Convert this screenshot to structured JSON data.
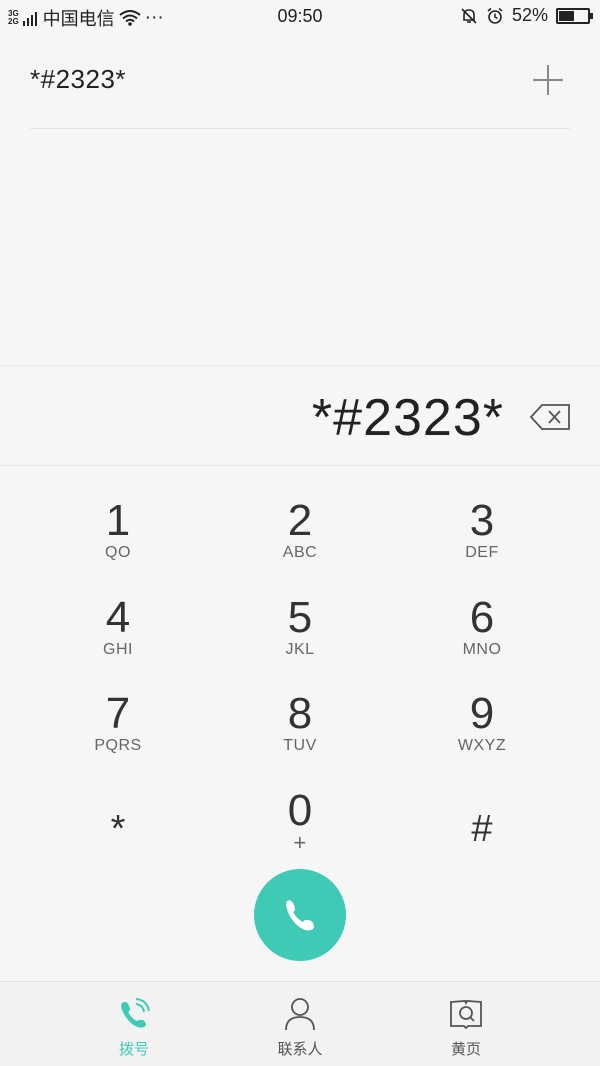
{
  "status_bar": {
    "network_top": "3G",
    "network_bottom": "2G",
    "carrier": "中国电信",
    "more": "···",
    "time": "09:50",
    "battery_text": "52%",
    "battery_level": 0.52
  },
  "header": {
    "number": "*#2323*"
  },
  "dialer": {
    "display": "*#2323*"
  },
  "keys": [
    {
      "digit": "1",
      "letters": "QO"
    },
    {
      "digit": "2",
      "letters": "ABC"
    },
    {
      "digit": "3",
      "letters": "DEF"
    },
    {
      "digit": "4",
      "letters": "GHI"
    },
    {
      "digit": "5",
      "letters": "JKL"
    },
    {
      "digit": "6",
      "letters": "MNO"
    },
    {
      "digit": "7",
      "letters": "PQRS"
    },
    {
      "digit": "8",
      "letters": "TUV"
    },
    {
      "digit": "9",
      "letters": "WXYZ"
    },
    {
      "digit": "*",
      "letters": ""
    },
    {
      "digit": "0",
      "letters": "+"
    },
    {
      "digit": "#",
      "letters": ""
    }
  ],
  "nav": {
    "dial_label": "拨号",
    "contacts_label": "联系人",
    "yellow_pages_label": "黄页"
  },
  "colors": {
    "accent": "#3fcab5",
    "background": "#f6f6f6"
  },
  "icons": {
    "add": "plus-icon",
    "backspace": "backspace-icon",
    "call": "phone-icon",
    "voicemail": "voicemail-icon",
    "nav_dial": "phone-call-icon",
    "nav_contacts": "person-icon",
    "nav_yellow_pages": "book-search-icon"
  }
}
